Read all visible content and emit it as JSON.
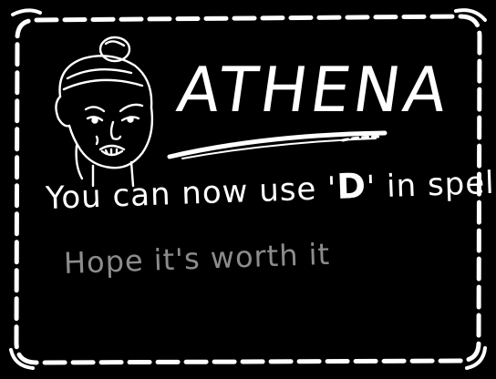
{
  "unlock_card": {
    "character_name": "ATHENA",
    "message": {
      "prefix": "You can now use ",
      "quote_open": "'",
      "key": "D",
      "quote_close": "'",
      "suffix": " in spells"
    },
    "subtext": "Hope it's worth it"
  },
  "colors": {
    "background": "#000000",
    "foreground": "#ffffff",
    "subtext": "#8c8c8c"
  },
  "icons": {
    "portrait": "athena-portrait",
    "frame": "dashed-border-frame"
  }
}
